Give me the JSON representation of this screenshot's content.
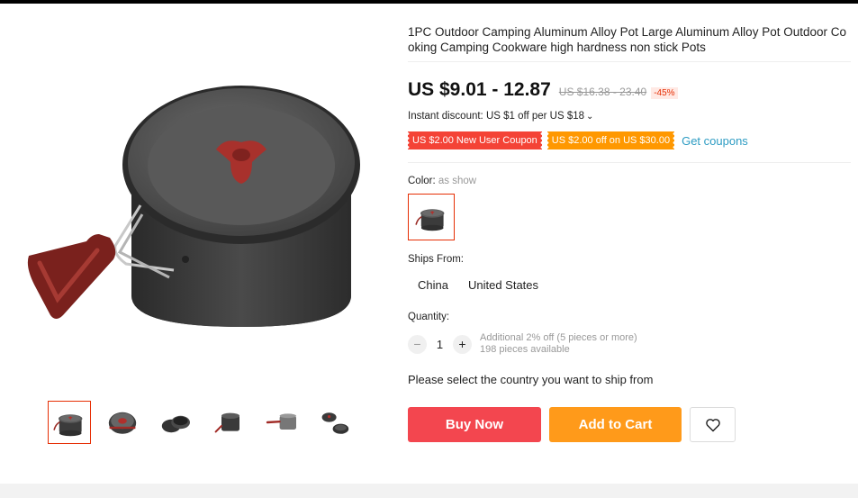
{
  "product": {
    "title": "1PC Outdoor Camping Aluminum Alloy Pot Large Aluminum Alloy Pot Outdoor Cooking Camping Cookware high hardness non stick Pots",
    "price": "US $9.01 - 12.87",
    "original_price": "US $16.38 - 23.40",
    "discount": "-45%"
  },
  "promotions": {
    "instant_discount": "Instant discount: US $1 off per US $18",
    "coupon_new_user": "US $2.00 New User Coupon",
    "coupon_off": "US $2.00 off on US $30.00",
    "get_coupons": "Get coupons"
  },
  "color": {
    "label": "Color:",
    "value": "as show"
  },
  "shipping": {
    "label": "Ships From:",
    "options": [
      "China",
      "United States"
    ],
    "message": "Please select the country you want to ship from"
  },
  "quantity": {
    "label": "Quantity:",
    "minus": "−",
    "plus": "+",
    "value": "1",
    "note_discount": "Additional 2% off (5 pieces or more)",
    "note_available": "198 pieces available"
  },
  "actions": {
    "buy_now": "Buy Now",
    "add_to_cart": "Add to Cart"
  },
  "icons": {
    "wishlist": "heart-icon",
    "instant_dropdown": "chevron-down-icon"
  },
  "colors": {
    "buy_now": "#f3464f",
    "add_to_cart": "#ff9a1a",
    "coupon_red": "#f44336",
    "coupon_orange": "#ff9800",
    "link": "#2e9cc3",
    "selected_border": "#e62e04"
  },
  "gallery": {
    "thumbnail_count": 6,
    "selected_index": 0
  }
}
